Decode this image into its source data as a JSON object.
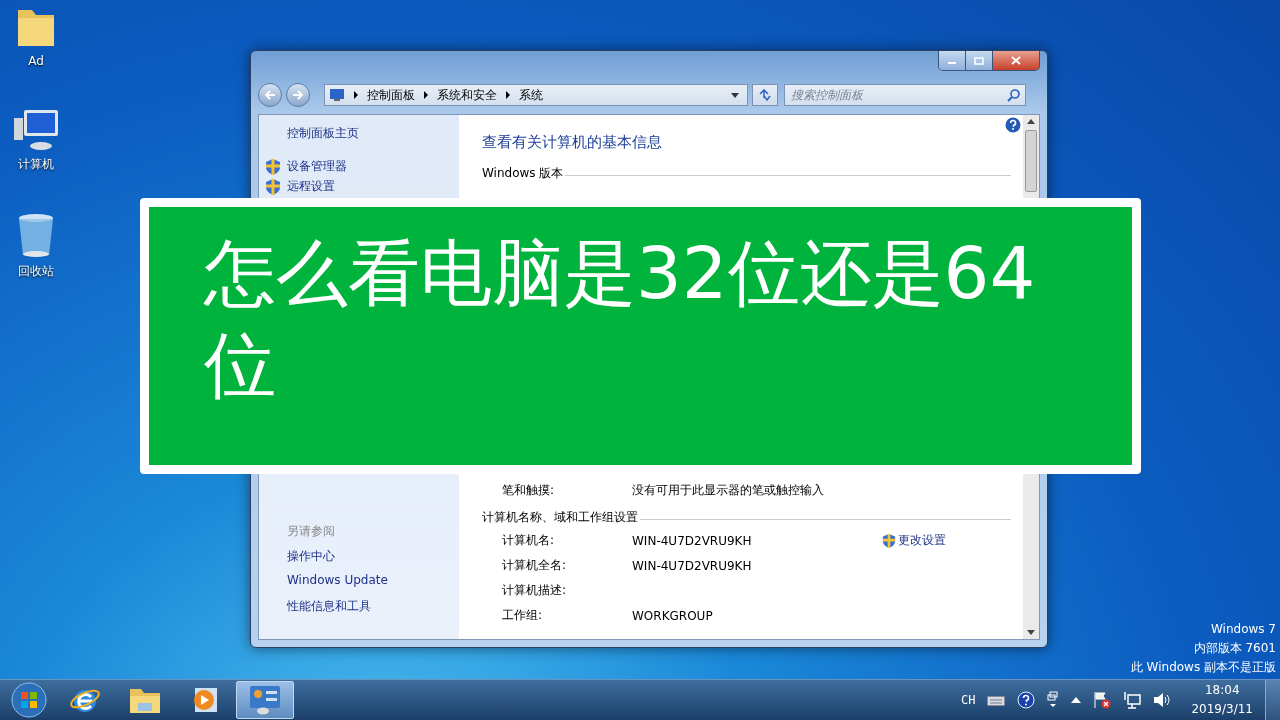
{
  "desktop_icons": [
    {
      "kind": "folder",
      "label": "Ad"
    },
    {
      "kind": "computer",
      "label": "计算机"
    },
    {
      "kind": "recycle_bin",
      "label": "回收站"
    }
  ],
  "window": {
    "breadcrumb": [
      "控制面板",
      "系统和安全",
      "系统"
    ],
    "search": {
      "placeholder": "搜索控制面板"
    },
    "sidebar": {
      "home": "控制面板主页",
      "tasks": [
        "设备管理器",
        "远程设置"
      ],
      "see_also_title": "另请参阅",
      "see_also": [
        "操作中心",
        "Windows Update",
        "性能信息和工具"
      ]
    },
    "main": {
      "title": "查看有关计算机的基本信息",
      "section_1": "Windows 版本",
      "pen_row": {
        "label": "笔和触摸:",
        "value": "没有可用于此显示器的笔或触控输入"
      },
      "section_2": "计算机名称、域和工作组设置",
      "rows": [
        {
          "label": "计算机名:",
          "value": "WIN-4U7D2VRU9KH",
          "link": "更改设置"
        },
        {
          "label": "计算机全名:",
          "value": "WIN-4U7D2VRU9KH"
        },
        {
          "label": "计算机描述:"
        },
        {
          "label": "工作组:",
          "value": "WORKGROUP"
        }
      ]
    }
  },
  "overlay_title": "怎么看电脑是32位还是64位",
  "activation_notice": [
    "Windows 7",
    "内部版本 7601",
    "此 Windows 副本不是正版"
  ],
  "taskbar": {
    "items": [
      {
        "kind": "start",
        "selected": false
      },
      {
        "kind": "browser",
        "selected": false
      },
      {
        "kind": "explorer",
        "selected": false
      },
      {
        "kind": "media",
        "selected": false
      },
      {
        "kind": "control_panel",
        "selected": true
      }
    ],
    "tray": {
      "language": "CH",
      "time": "18:04",
      "date": "2019/3/11"
    }
  }
}
